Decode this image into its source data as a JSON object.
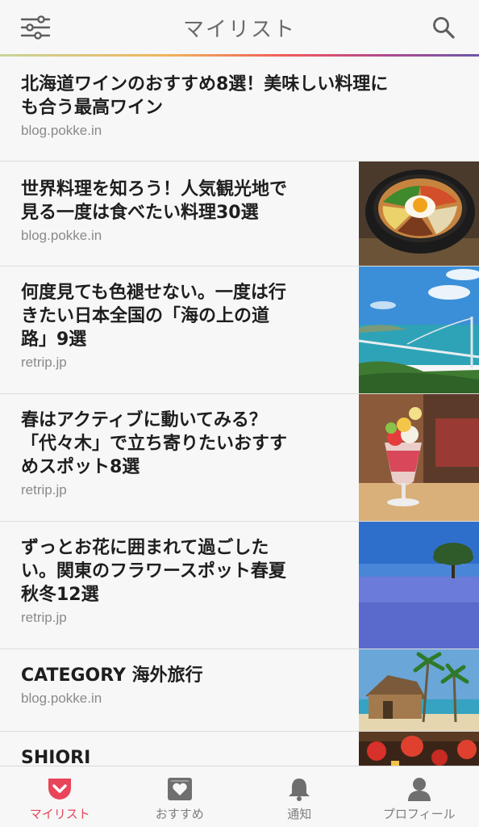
{
  "header": {
    "title": "マイリスト",
    "left_icon": "filter-settings-icon",
    "right_icon": "search-icon"
  },
  "colors": {
    "accent": "#e8455a",
    "text": "#1e1e1e",
    "muted": "#8a8a8a",
    "background": "#f7f7f7"
  },
  "items": [
    {
      "title_lines": [
        "北海道ワインのおすすめ8選！美味しい料理に",
        "も合う最高ワイン"
      ],
      "source": "blog.pokke.in",
      "thumbnail": ""
    },
    {
      "title_lines": [
        "世界料理を知ろう！人気観光地で",
        "見る一度は食べたい料理30選"
      ],
      "source": "blog.pokke.in",
      "thumbnail": "bibimbap"
    },
    {
      "title_lines": [
        "何度見ても色褪せない。一度は行",
        "きたい日本全国の「海の上の道",
        "路」9選"
      ],
      "source": "retrip.jp",
      "thumbnail": "sea-bridge"
    },
    {
      "title_lines": [
        "春はアクティブに動いてみる？",
        "「代々木」で立ち寄りたいおすす",
        "めスポット8選"
      ],
      "source": "retrip.jp",
      "thumbnail": "parfait"
    },
    {
      "title_lines": [
        "ずっとお花に囲まれて過ごした",
        "い。関東のフラワースポット春夏",
        "秋冬12選"
      ],
      "source": "retrip.jp",
      "thumbnail": "flower-field"
    },
    {
      "title_lines": [
        "CATEGORY 海外旅行"
      ],
      "source": "blog.pokke.in",
      "thumbnail": "beach-hut"
    },
    {
      "title_lines": [
        "SHIORI"
      ],
      "source": "",
      "thumbnail": "lanterns"
    }
  ],
  "tabs": [
    {
      "label": "マイリスト",
      "icon": "pocket-icon",
      "active": true
    },
    {
      "label": "おすすめ",
      "icon": "recommend-heart-icon",
      "active": false
    },
    {
      "label": "通知",
      "icon": "bell-icon",
      "active": false
    },
    {
      "label": "プロフィール",
      "icon": "profile-icon",
      "active": false
    }
  ]
}
